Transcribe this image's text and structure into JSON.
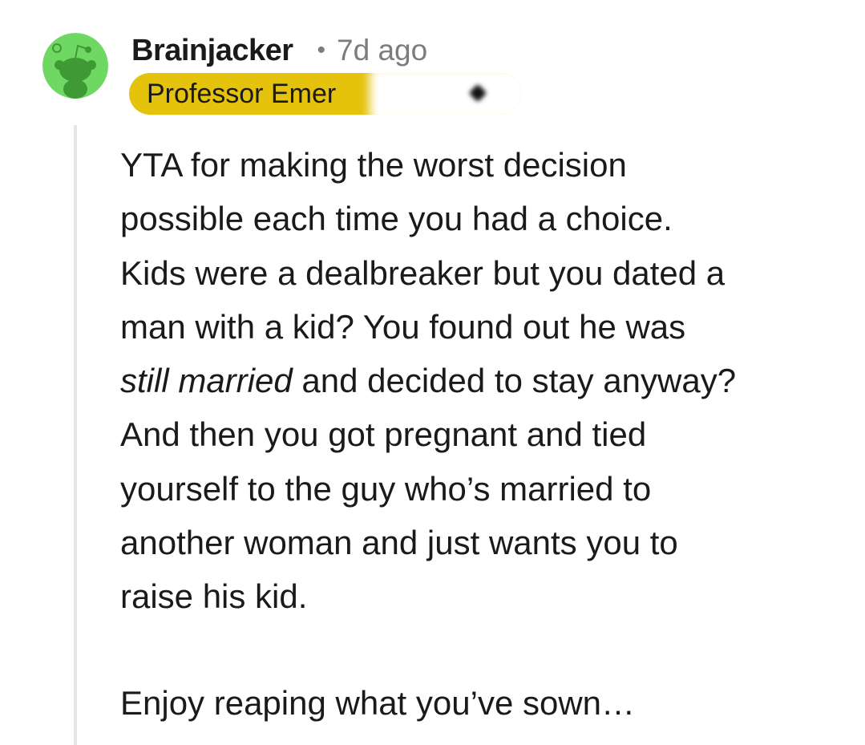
{
  "comment": {
    "author": {
      "username": "Brainjacker",
      "avatar_icon": "snoo-avatar-icon",
      "avatar_color": "#6ed862"
    },
    "separator": "•",
    "timestamp": "7d ago",
    "flair": {
      "text": "Professor Emer",
      "background": "#e5c20c",
      "redacted": true
    },
    "body": {
      "p1_lines": [
        "YTA for making the worst decision",
        "possible each time you had a choice.",
        "Kids were a dealbreaker but you dated a",
        "man with a kid? You found out he was"
      ],
      "p1_italic": "still married",
      "p1_after_italic": " and decided to stay anyway?",
      "p1_rest_lines": [
        "And then you got pregnant and tied",
        "yourself to the guy who’s married to",
        "another woman and just wants you to",
        "raise his kid."
      ],
      "p2": "Enjoy reaping what you’ve sown…"
    }
  }
}
